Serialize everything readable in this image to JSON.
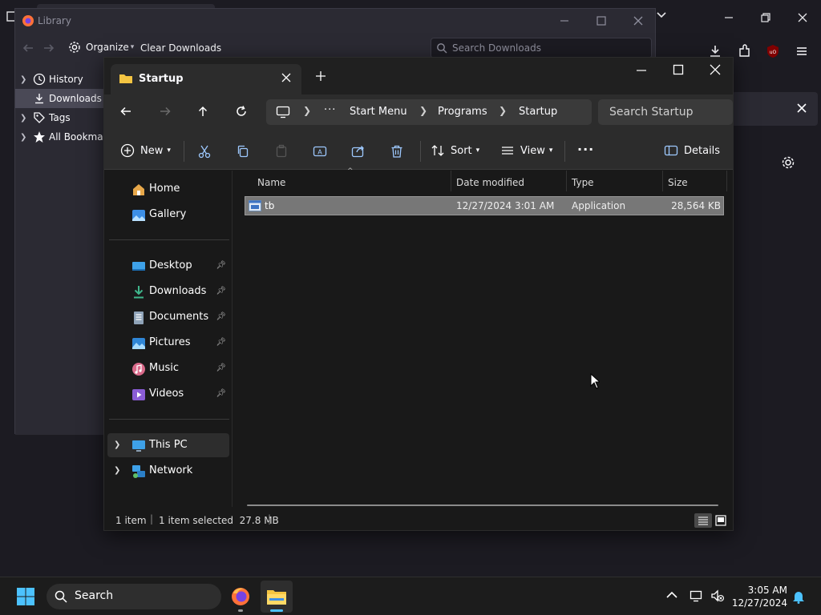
{
  "library": {
    "title": "Library",
    "toolbar": {
      "organize": "Organize",
      "clear": "Clear Downloads"
    },
    "search_placeholder": "Search Downloads",
    "tree": [
      "History",
      "Downloads",
      "Tags",
      "All Bookmarks"
    ]
  },
  "explorer": {
    "tab_title": "Startup",
    "breadcrumb": [
      "Start Menu",
      "Programs",
      "Startup"
    ],
    "search_placeholder": "Search Startup",
    "commands": {
      "new": "New",
      "sort": "Sort",
      "view": "View",
      "details": "Details"
    },
    "nav": {
      "top": [
        "Home",
        "Gallery"
      ],
      "pinned": [
        "Desktop",
        "Downloads",
        "Documents",
        "Pictures",
        "Music",
        "Videos"
      ],
      "bottom": [
        "This PC",
        "Network"
      ]
    },
    "columns": [
      "Name",
      "Date modified",
      "Type",
      "Size"
    ],
    "rows": [
      {
        "name": "tb",
        "date": "12/27/2024 3:01 AM",
        "type": "Application",
        "size": "28,564 KB"
      }
    ],
    "status": {
      "count": "1 item",
      "selected": "1 item selected  27.8 MB"
    }
  },
  "taskbar": {
    "search": "Search",
    "time": "3:05 AM",
    "date": "12/27/2024"
  },
  "colors": {
    "accent": "#4cc2ff",
    "folder": "#f4c542",
    "firefox": "#ff7139",
    "ublock": "#800000"
  }
}
